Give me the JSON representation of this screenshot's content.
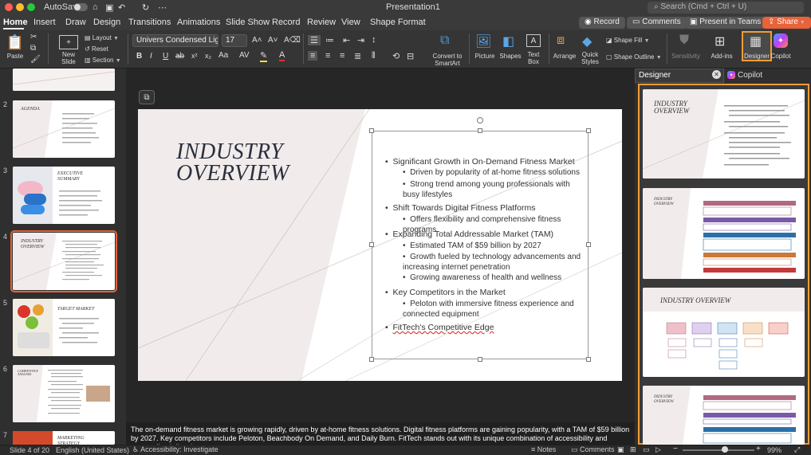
{
  "titlebar": {
    "autosave": "AutoSave",
    "title": "Presentation1",
    "search": "Search (Cmd + Ctrl + U)"
  },
  "tabs": [
    "Home",
    "Insert",
    "Draw",
    "Design",
    "Transitions",
    "Animations",
    "Slide Show",
    "Record",
    "Review",
    "View",
    "Shape Format"
  ],
  "actions": {
    "record": "Record",
    "comments": "Comments",
    "present": "Present in Teams",
    "share": "Share"
  },
  "ribbon": {
    "paste": "Paste",
    "new_slide": "New\nSlide",
    "layout": "Layout",
    "reset": "Reset",
    "section": "Section",
    "font": "Univers Condensed Ligh...",
    "size": "17",
    "convert": "Convert to\nSmartArt",
    "picture": "Picture",
    "shapes": "Shapes",
    "textbox": "Text\nBox",
    "arrange": "Arrange",
    "quick_styles": "Quick\nStyles",
    "shape_fill": "Shape Fill",
    "shape_outline": "Shape Outline",
    "sensitivity": "Sensitivity",
    "addins": "Add-ins",
    "designer": "Designer",
    "copilot": "Copilot"
  },
  "thumbs": [
    {
      "num": "2",
      "title": "AGENDA"
    },
    {
      "num": "3",
      "title": "EXECUTIVE\nSUMMARY"
    },
    {
      "num": "4",
      "title": "INDUSTRY\nOVERVIEW"
    },
    {
      "num": "5",
      "title": "TARGET MARKET"
    },
    {
      "num": "6",
      "title": "COMPETITIVE\nANALYSIS"
    },
    {
      "num": "7",
      "title": "MARKETING\nSTRATEGY"
    }
  ],
  "slide": {
    "title_line1": "INDUSTRY",
    "title_line2": "OVERVIEW",
    "bullets": [
      {
        "text": "Significant Growth in On-Demand Fitness Market",
        "subs": [
          "Driven by popularity of at-home fitness solutions",
          "Strong trend among young professionals with busy lifestyles"
        ]
      },
      {
        "text": "Shift Towards Digital Fitness Platforms",
        "subs": [
          "Offers flexibility and comprehensive fitness programs"
        ]
      },
      {
        "text": "Expanding Total Addressable Market (TAM)",
        "subs": [
          "Estimated TAM of $59 billion by 2027",
          "Growth fueled by technology advancements and increasing internet penetration",
          "Growing awareness of health and wellness"
        ]
      },
      {
        "text": "Key Competitors in the Market",
        "subs": [
          "Peloton with immersive fitness experience and connected equipment"
        ]
      },
      {
        "text": "FitTech's Competitive Edge",
        "subs": []
      }
    ]
  },
  "notes": "The on-demand fitness market is growing rapidly, driven by at-home fitness solutions. Digital fitness platforms are gaining popularity, with a TAM of $59 billion by 2027. Key competitors include Peloton, Beachbody On Demand, and Daily Burn. FitTech stands out with its unique combination of accessibility and personalized diet plans.",
  "designer": {
    "tab1": "Designer",
    "tab2": "Copilot",
    "card_title": "INDUSTRY OVERVIEW"
  },
  "status": {
    "slide": "Slide 4 of 20",
    "language": "English (United States)",
    "accessibility": "Accessibility: Investigate",
    "notes": "Notes",
    "comments": "Comments",
    "zoom": "99%"
  }
}
